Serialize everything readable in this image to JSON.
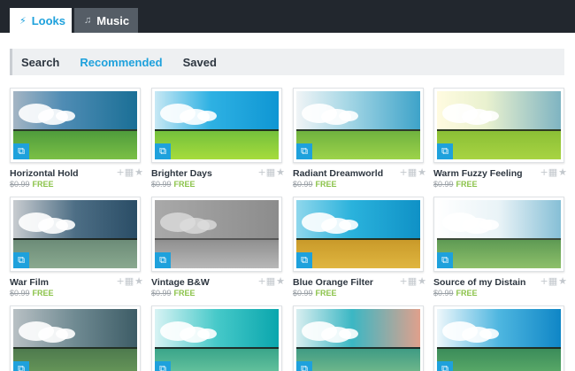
{
  "tabs": [
    {
      "label": "Looks",
      "icon": "lightning-icon",
      "active": true
    },
    {
      "label": "Music",
      "icon": "music-note-icon",
      "active": false
    }
  ],
  "subnav": [
    {
      "label": "Search",
      "active": false
    },
    {
      "label": "Recommended",
      "active": true
    },
    {
      "label": "Saved",
      "active": false
    }
  ],
  "colors": {
    "accent": "#1ea1dc",
    "free": "#8bc34a",
    "topbar": "#22272e"
  },
  "looks": [
    {
      "title": "Horizontal Hold",
      "old_price": "$0.99",
      "price": "FREE"
    },
    {
      "title": "Brighter Days",
      "old_price": "$0.99",
      "price": "FREE"
    },
    {
      "title": "Radiant Dreamworld",
      "old_price": "$0.99",
      "price": "FREE"
    },
    {
      "title": "Warm Fuzzy Feeling",
      "old_price": "$0.99",
      "price": "FREE"
    },
    {
      "title": "War Film",
      "old_price": "$0.99",
      "price": "FREE"
    },
    {
      "title": "Vintage B&W",
      "old_price": "$0.99",
      "price": "FREE"
    },
    {
      "title": "Blue Orange Filter",
      "old_price": "$0.99",
      "price": "FREE"
    },
    {
      "title": "Source of my Distain",
      "old_price": "$0.99",
      "price": "FREE"
    }
  ],
  "card_actions": {
    "add_icon": "add-grid-icon",
    "favorite_icon": "star-icon"
  }
}
